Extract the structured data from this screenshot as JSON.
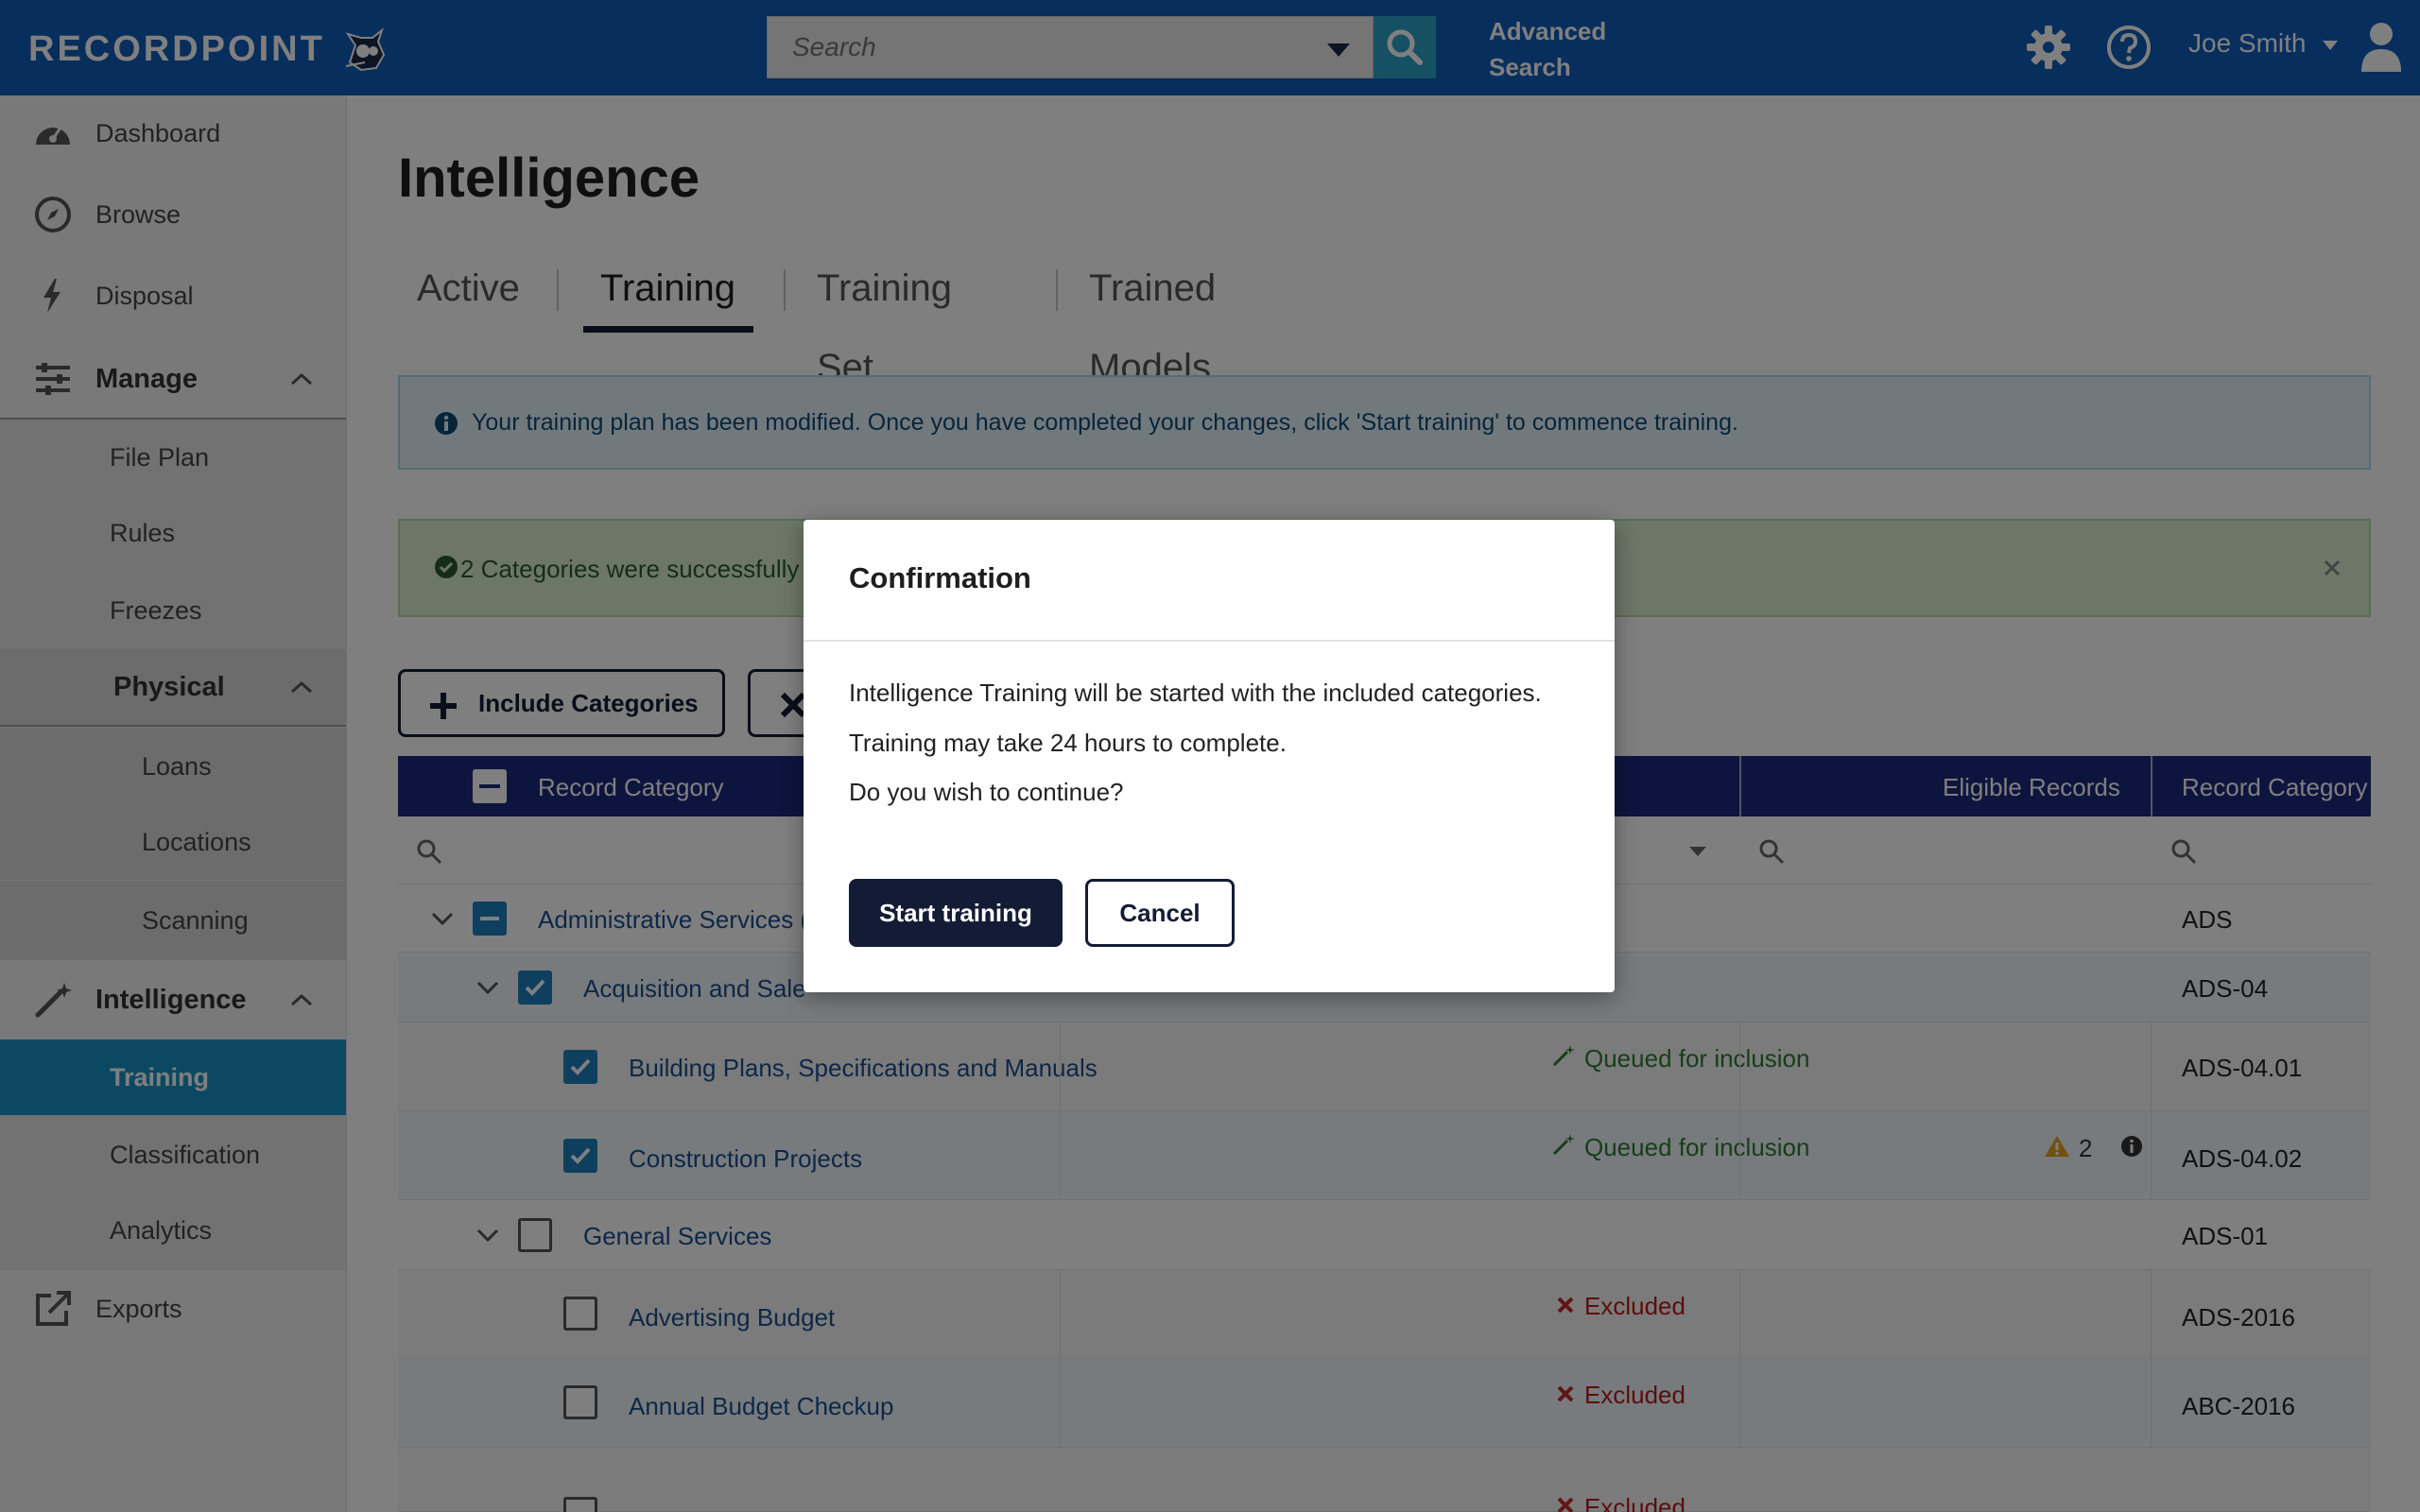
{
  "header": {
    "logo_text": "RECORDPOINT",
    "search_placeholder": "Search",
    "advanced_search_line1": "Advanced",
    "advanced_search_line2": "Search",
    "user_name": "Joe Smith"
  },
  "colors": {
    "topbar": "#0e5db8",
    "accent": "#1793c7",
    "navy": "#141c35",
    "table_header": "#1a2a7c"
  },
  "sidebar": {
    "dashboard": "Dashboard",
    "browse": "Browse",
    "disposal": "Disposal",
    "manage": "Manage",
    "file_plan": "File Plan",
    "rules": "Rules",
    "freezes": "Freezes",
    "physical": "Physical",
    "loans": "Loans",
    "locations": "Locations",
    "scanning": "Scanning",
    "intelligence": "Intelligence",
    "training": "Training",
    "classification": "Classification",
    "analytics": "Analytics",
    "exports": "Exports"
  },
  "page": {
    "title": "Intelligence",
    "tabs": [
      "Active",
      "Training",
      "Training Set",
      "Trained Models"
    ],
    "active_tab": "Training",
    "info_banner": "Your training plan has been modified. Once you have completed your changes, click 'Start training' to commence training.",
    "success_banner": "2 Categories were successfully",
    "include_button": "Include Categories"
  },
  "table": {
    "headers": {
      "record_category": "Record Category",
      "eligible_records": "Eligible Records",
      "record_category_code": "Record Category"
    },
    "rows": [
      {
        "name": "Administrative Services (",
        "status": "",
        "code": "ADS"
      },
      {
        "name": "Acquisition and Sale",
        "status": "",
        "code": "ADS-04"
      },
      {
        "name": "Building Plans, Specifications and Manuals",
        "status": "Queued for inclusion",
        "code": "ADS-04.01"
      },
      {
        "name": "Construction Projects",
        "status": "Queued for inclusion",
        "code": "ADS-04.02",
        "warning_count": "2"
      },
      {
        "name": "General Services",
        "status": "",
        "code": "ADS-01"
      },
      {
        "name": "Advertising Budget",
        "status": "Excluded",
        "code": "ADS-2016"
      },
      {
        "name": "Annual Budget Checkup",
        "status": "Excluded",
        "code": "ABC-2016"
      },
      {
        "name": "",
        "status": "Excluded",
        "code": ""
      }
    ]
  },
  "modal": {
    "title": "Confirmation",
    "line1": "Intelligence Training will be started with the included categories.",
    "line2": "Training may take 24 hours to complete.",
    "line3": "Do you wish to continue?",
    "start_button": "Start training",
    "cancel_button": "Cancel"
  }
}
